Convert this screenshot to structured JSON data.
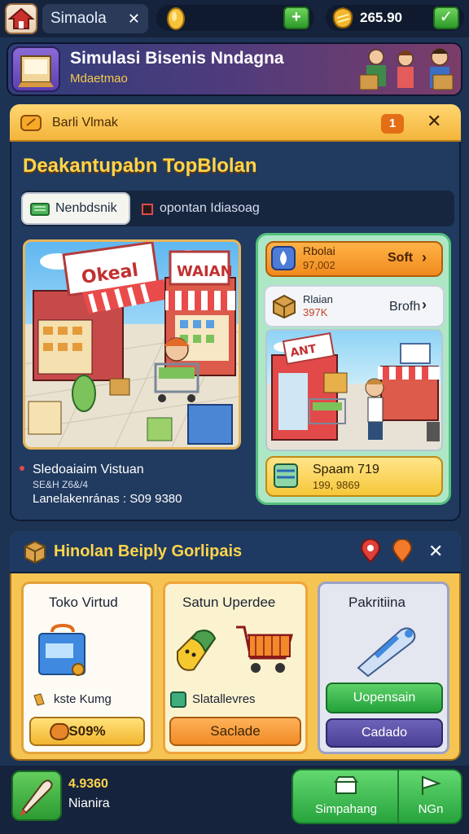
{
  "topbar": {
    "sim_label": "Simaola",
    "gold_value": "265.90"
  },
  "banner": {
    "title": "Simulasi Bisenis Nndagna",
    "subtitle": "Mdaetmao"
  },
  "panel1": {
    "header_title": "Barli Vlmak",
    "badge": "1",
    "headline": "Deakantupabn TopBlolan",
    "tabs": [
      {
        "label": "Nenbdsnik"
      },
      {
        "label": "opontan Idiasoag"
      }
    ],
    "store_signs": [
      "Okeal",
      "WAIAN"
    ],
    "right": {
      "card1": {
        "title": "Rbolai",
        "sub": "97,002",
        "value": "Soft"
      },
      "card2": {
        "title": "Rlaian",
        "sub": "397K",
        "value": "Brofh"
      },
      "scene_sign": "ANT",
      "card3": {
        "title": "Spaam 719",
        "sub": "199, 9869"
      }
    },
    "owner": {
      "name": "Sledoaiaim Vistuan",
      "sub": "SE&H Z6&/4",
      "line": "Lanelakenránas : S09 9380"
    }
  },
  "panel2": {
    "title": "Hinolan Beiply Gorlipais",
    "cards": [
      {
        "title": "Toko Virtud",
        "label": "kste Kumg",
        "price": "S09%"
      },
      {
        "title": "Satun Uperdee",
        "label": "Slatallevres",
        "action": "Saclade"
      },
      {
        "title": "Pakritiina",
        "primary": "Uopensain",
        "secondary": "Cadado"
      }
    ]
  },
  "bottombar": {
    "value": "4.9360",
    "name": "Nianira",
    "shop_label": "Simpahang",
    "next_label": "NGn"
  },
  "colors": {
    "accent_yellow": "#ffd54a",
    "panel_blue": "#213a5f",
    "green": "#2ea23e",
    "orange": "#f08a1e"
  }
}
